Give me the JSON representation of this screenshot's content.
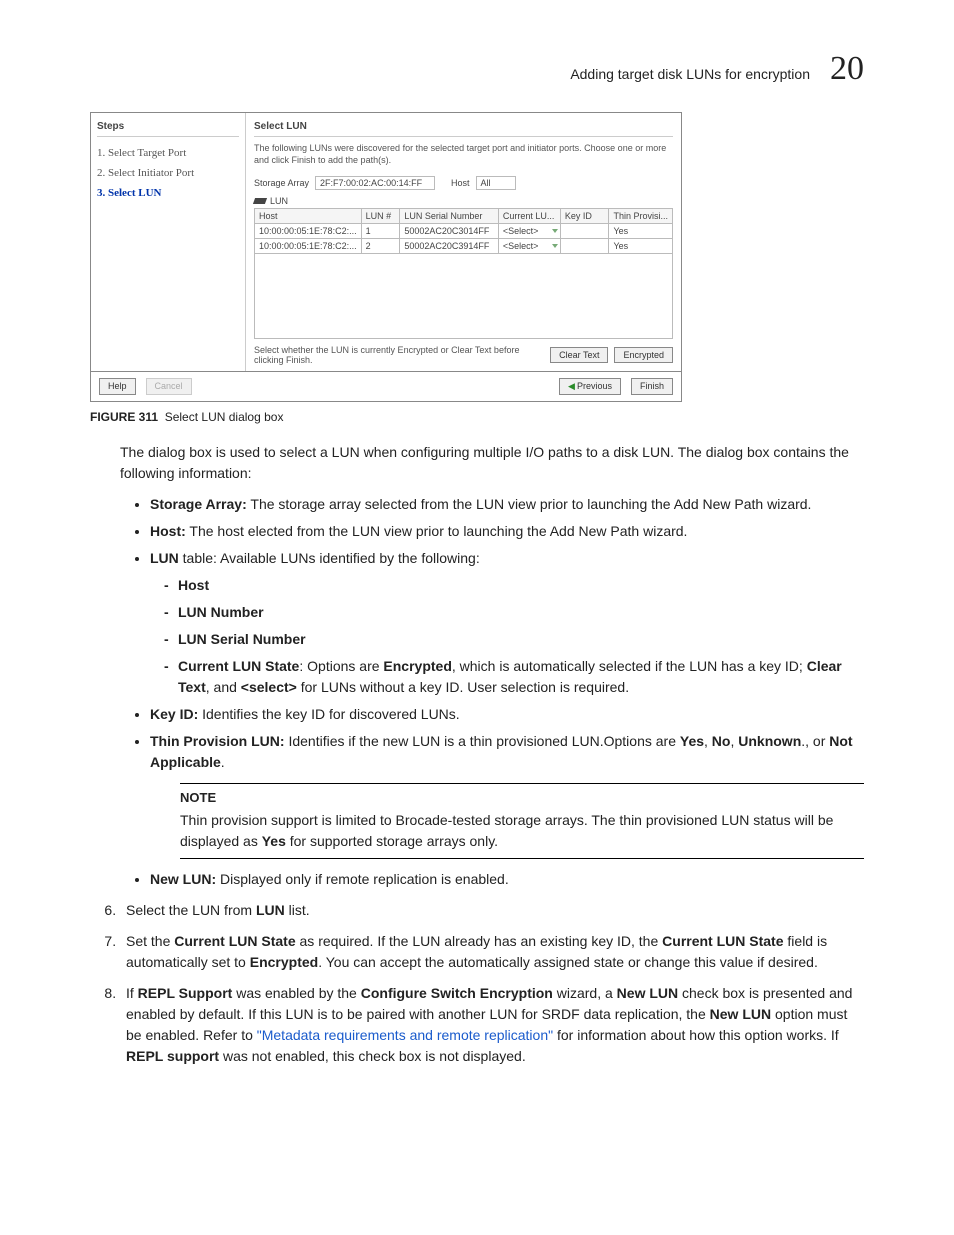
{
  "header": {
    "title": "Adding target disk LUNs for encryption",
    "chapter_num": "20"
  },
  "dialog": {
    "steps_title": "Steps",
    "steps": [
      {
        "label": "1. Select Target Port",
        "active": false
      },
      {
        "label": "2. Select Initiator Port",
        "active": false
      },
      {
        "label": "3. Select LUN",
        "active": true
      }
    ],
    "content_title": "Select LUN",
    "description": "The following LUNs were discovered for the selected target port and initiator ports. Choose one or more and click Finish to add the path(s).",
    "storage_array_label": "Storage Array",
    "storage_array_value": "2F:F7:00:02:AC:00:14:FF",
    "host_label": "Host",
    "host_value": "All",
    "lun_heading": "LUN",
    "table": {
      "headers": [
        "Host",
        "LUN #",
        "LUN Serial Number",
        "Current LU...",
        "Key ID",
        "Thin Provisi..."
      ],
      "rows": [
        {
          "host": "10:00:00:05:1E:78:C2:...",
          "lun": "1",
          "serial": "50002AC20C3014FF",
          "state": "<Select>",
          "key": "",
          "thin": "Yes"
        },
        {
          "host": "10:00:00:05:1E:78:C2:...",
          "lun": "2",
          "serial": "50002AC20C3914FF",
          "state": "<Select>",
          "key": "",
          "thin": "Yes"
        }
      ]
    },
    "bottom_text": "Select whether the LUN is currently Encrypted or Clear Text before clicking Finish.",
    "btn_clear": "Clear Text",
    "btn_encrypted": "Encrypted",
    "btn_help": "Help",
    "btn_cancel": "Cancel",
    "btn_previous": "Previous",
    "btn_finish": "Finish"
  },
  "figure": {
    "label": "FIGURE 311",
    "caption": "Select LUN dialog box"
  },
  "body": {
    "intro": "The dialog box is used to select a LUN when configuring multiple I/O paths to a disk LUN. The dialog box contains the following information:",
    "sa_label": "Storage Array:",
    "sa_text": " The storage array selected from the LUN view prior to launching the Add New Path wizard.",
    "hst_label": "Host:",
    "hst_text": " The host elected from the LUN view prior to launching the Add New Path wizard.",
    "lun_label": "LUN",
    "lun_text": " table: Available LUNs identified by the following:",
    "d1": "Host",
    "d2": "LUN Number",
    "d3": "LUN Serial Number",
    "d4a": "Current LUN State",
    "d4b": ": Options are ",
    "d4c": "Encrypted",
    "d4d": ", which is automatically selected if the LUN has a key ID; ",
    "d4e": "Clear Text",
    "d4f": ", and ",
    "d4g": "<select>",
    "d4h": " for LUNs without a key ID. User selection is required.",
    "key_label": "Key ID:",
    "key_text": " Identifies the key ID for discovered LUNs.",
    "tp_label": "Thin Provision LUN:",
    "tp_text1": " Identifies if the new LUN is a thin provisioned LUN.Options are ",
    "tp_yes": "Yes",
    "tp_c1": ", ",
    "tp_no": "No",
    "tp_c2": ", ",
    "tp_unk": "Unknown",
    "tp_c3": "., or ",
    "tp_na": "Not Applicable",
    "tp_end": ".",
    "note_title": "NOTE",
    "note_body1": "Thin provision support is limited to Brocade-tested storage arrays. The thin provisioned LUN status will be displayed as ",
    "note_yes": "Yes",
    "note_body2": " for supported storage arrays only.",
    "nl_label": "New LUN:",
    "nl_text": " Displayed only if remote replication is enabled.",
    "step6a": "Select the LUN from ",
    "step6b": "LUN",
    "step6c": " list.",
    "step7a": "Set the ",
    "step7b": "Current LUN State",
    "step7c": " as required. If the LUN already has an existing key ID, the ",
    "step7d": "Current LUN State",
    "step7e": " field is automatically set to ",
    "step7f": "Encrypted",
    "step7g": ". You can accept the automatically assigned state or change this value if desired.",
    "step8a": "If ",
    "step8b": "REPL Support",
    "step8c": " was enabled by the ",
    "step8d": "Configure Switch Encryption",
    "step8e": " wizard, a ",
    "step8f": "New LUN",
    "step8g": " check box is presented and enabled by default. If this LUN is to be paired with another LUN for SRDF data replication, the ",
    "step8h": "New LUN",
    "step8i": " option must be enabled. Refer to ",
    "step8j": "\"Metadata requirements and remote replication\"",
    "step8k": " for information about how this option works. If ",
    "step8l": "REPL support",
    "step8m": " was not enabled, this check box is not displayed."
  }
}
